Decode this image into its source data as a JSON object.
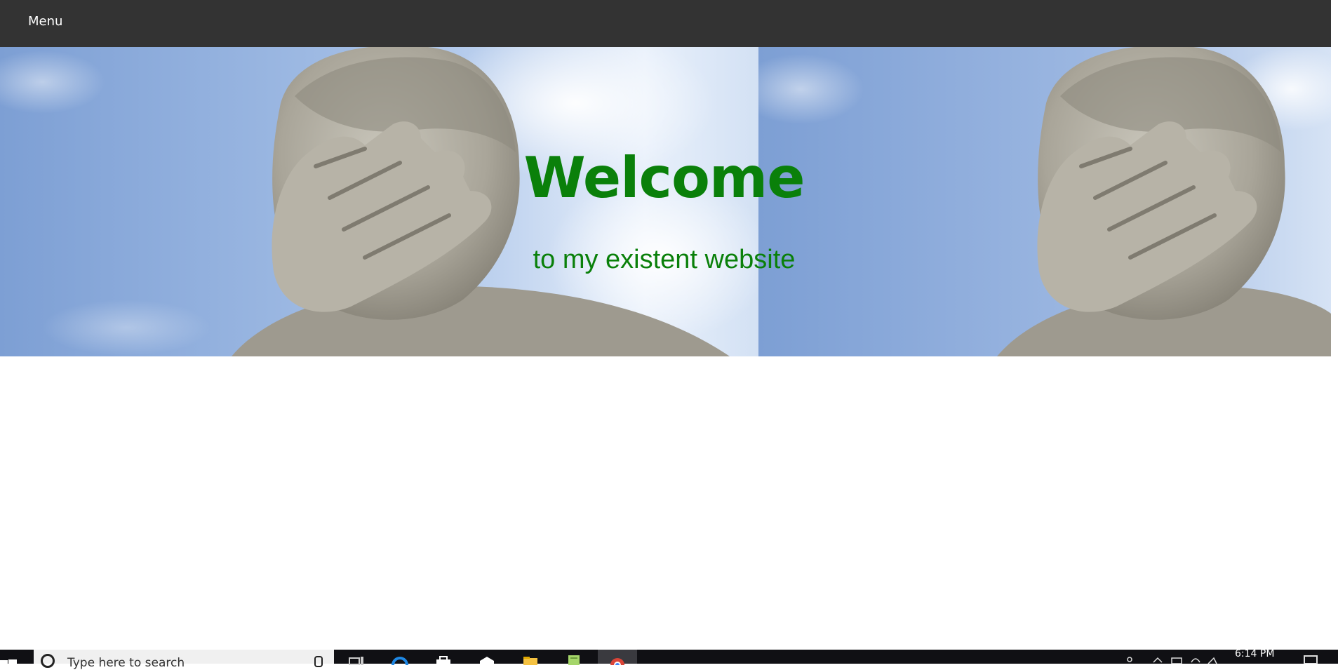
{
  "nav": {
    "menu_label": "Menu"
  },
  "hero": {
    "title": "Welcome",
    "subtitle": "to my existent website"
  },
  "taskbar": {
    "search_placeholder": "Type here to search",
    "clock_time": "6:14 PM",
    "pinned_apps": [
      "task-view",
      "edge",
      "store",
      "mail",
      "file-explorer",
      "notepad",
      "chrome"
    ]
  },
  "colors": {
    "nav_bg": "#333333",
    "hero_text": "#0a800a",
    "taskbar_bg": "#101014"
  }
}
